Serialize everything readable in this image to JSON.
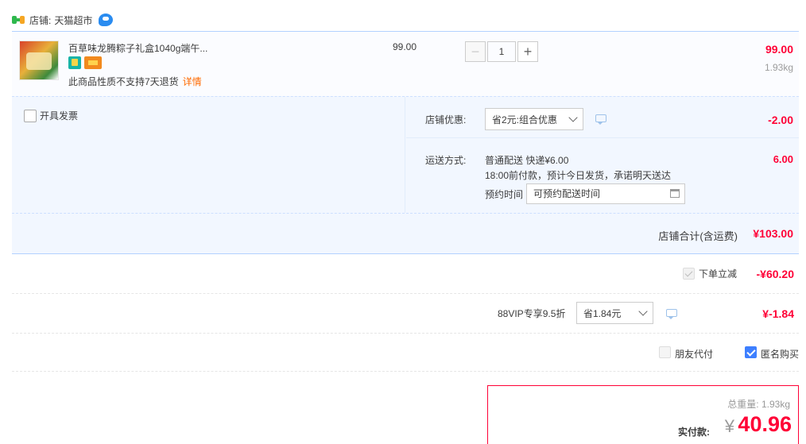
{
  "shop": {
    "label": "店铺:",
    "name": "天猫超市"
  },
  "item": {
    "title": "百草味龙腾粽子礼盒1040g端午...",
    "note": "此商品性质不支持7天退货",
    "detail_link": "详情",
    "unit_price": "99.00",
    "quantity": "1",
    "minus": "−",
    "plus": "+",
    "subtotal": "99.00",
    "weight": "1.93kg"
  },
  "invoice": {
    "label": "开具发票"
  },
  "shop_discount": {
    "label": "店铺优惠:",
    "selected": "省2元:组合优惠",
    "value": "-2.00"
  },
  "shipping": {
    "label": "运送方式:",
    "line1": "普通配送 快递¥6.00",
    "line2": "18:00前付款，预计今日发货，承诺明天送达",
    "time_label": "预约时间",
    "time_placeholder": "可预约配送时间",
    "fee": "6.00"
  },
  "shop_total": {
    "label": "店铺合计(含运费)",
    "value": "¥103.00"
  },
  "instant_discount": {
    "label": "下单立减",
    "value": "-¥60.20"
  },
  "vip": {
    "label": "88VIP专享9.5折",
    "selected": "省1.84元",
    "value": "¥-1.84"
  },
  "options": {
    "friend_pay": "朋友代付",
    "anonymous": "匿名购买"
  },
  "total": {
    "weight_text": "总重量: 1.93kg",
    "pay_label": "实付款:",
    "currency": "¥",
    "amount": "40.96"
  },
  "colors": {
    "accent": "#ff0036",
    "link": "#ff6a00",
    "panel": "#f2f7ff",
    "border_blue": "#b2d1ff",
    "checkbox_checked": "#3d7fff"
  }
}
